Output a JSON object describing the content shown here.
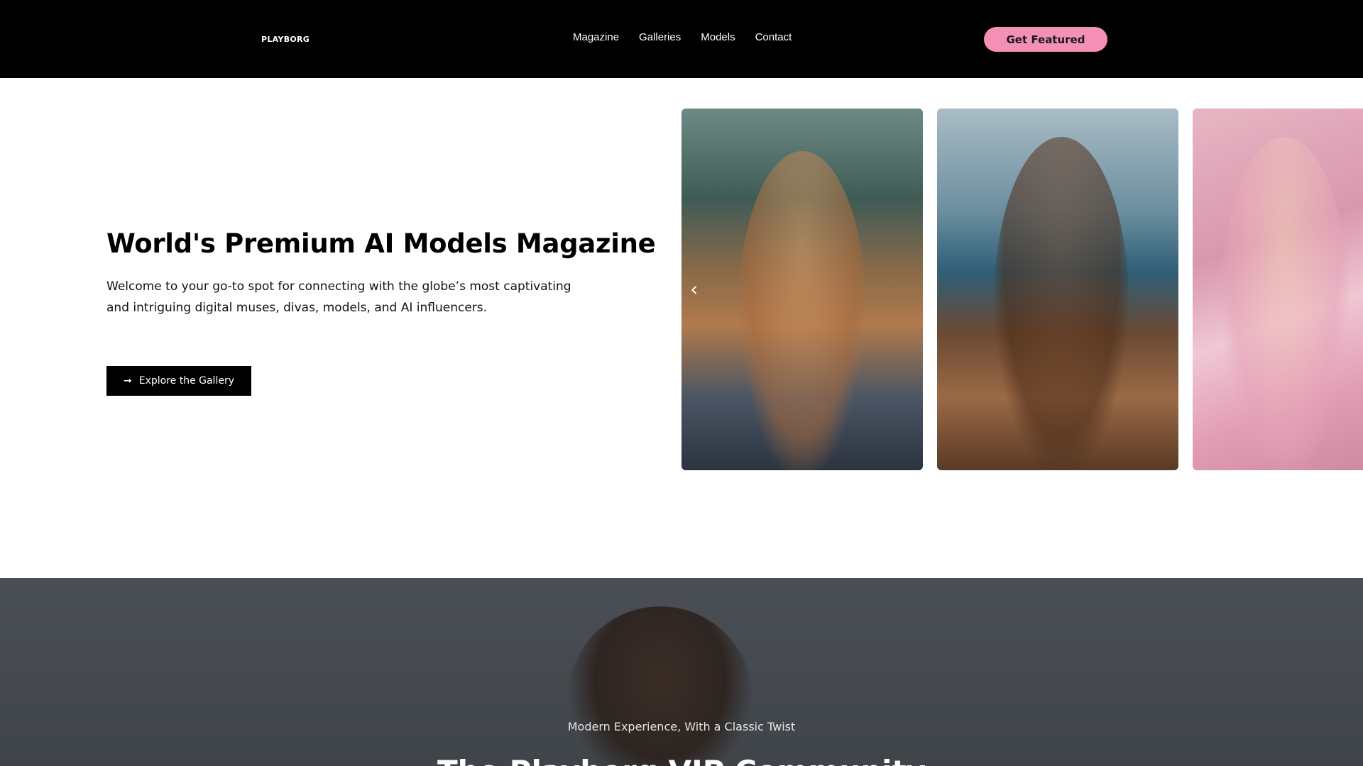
{
  "header": {
    "logo": "PLAYBORG",
    "nav": [
      "Magazine",
      "Galleries",
      "Models",
      "Contact"
    ],
    "cta_label": "Get Featured",
    "accent_color": "#f48fb5"
  },
  "hero": {
    "title": "World's Premium AI Models Magazine",
    "description": "Welcome to your go-to spot for connecting with the globe’s most captivating and intriguing digital muses, divas, models, and AI influencers.",
    "button_label": "Explore the Gallery",
    "button_icon": "arrow-right-icon"
  },
  "carousel": {
    "prev_icon": "chevron-left-icon",
    "prev_glyph": "‹"
  },
  "section": {
    "subtitle": "Modern Experience, With a Classic Twist",
    "title": "The Playborg VIP Community"
  }
}
